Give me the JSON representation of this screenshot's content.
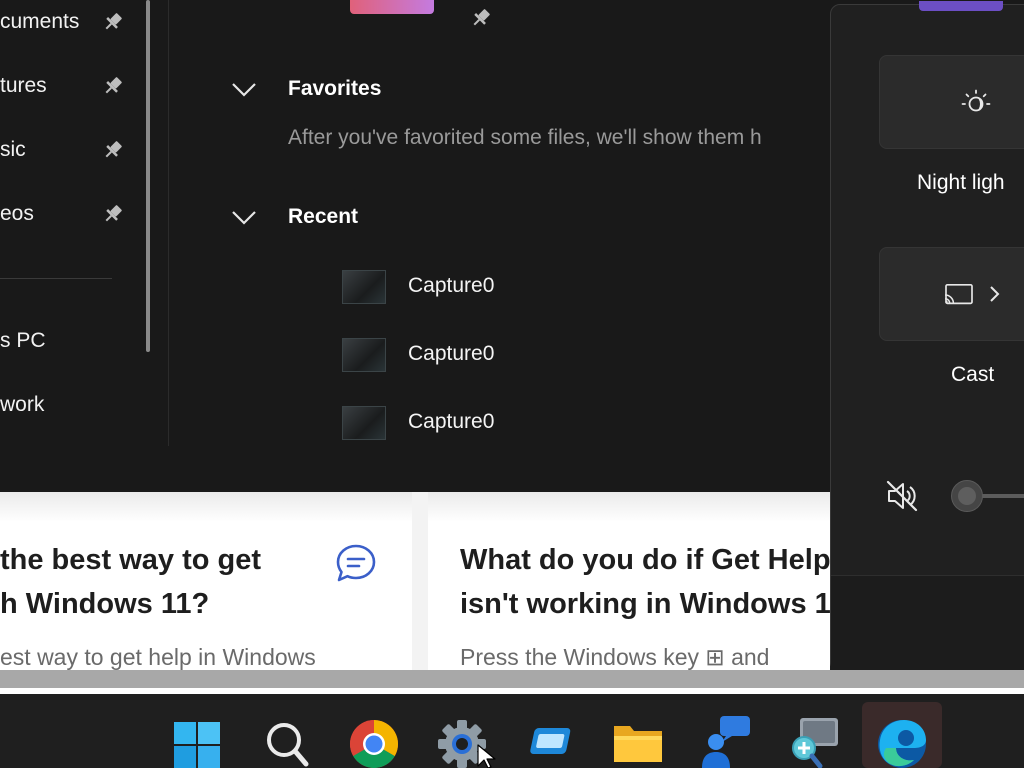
{
  "explorer": {
    "nav_items": [
      {
        "label": "cuments",
        "pinned": true
      },
      {
        "label": "tures",
        "pinned": true
      },
      {
        "label": "sic",
        "pinned": true
      },
      {
        "label": "eos",
        "pinned": true
      },
      {
        "label": "s PC",
        "pinned": false
      },
      {
        "label": "work",
        "pinned": false
      }
    ],
    "favorites": {
      "title": "Favorites",
      "message": "After you've favorited some files, we'll show them h"
    },
    "recent": {
      "title": "Recent",
      "items": [
        {
          "name": "Capture0"
        },
        {
          "name": "Capture0"
        },
        {
          "name": "Capture0"
        }
      ]
    }
  },
  "quick_settings": {
    "tiles": [
      {
        "label": "Night ligh",
        "icon": "night-light-icon"
      },
      {
        "label": "Cast",
        "icon": "cast-icon"
      }
    ],
    "volume": {
      "muted": true,
      "level": 0
    }
  },
  "help_page": {
    "cards": [
      {
        "title_line1": "the best way to get",
        "title_line2": "h Windows 11?",
        "body": "est way to get help in Windows"
      },
      {
        "title_line1": "What do you do if Get Help",
        "title_line2": "isn't working in Windows 1",
        "body": "Press the Windows key ⊞ and"
      }
    ]
  },
  "taskbar": {
    "apps": [
      {
        "name": "start-icon"
      },
      {
        "name": "search-icon"
      },
      {
        "name": "chrome-icon"
      },
      {
        "name": "settings-icon"
      },
      {
        "name": "app-window-icon"
      },
      {
        "name": "file-explorer-icon"
      },
      {
        "name": "get-help-icon"
      },
      {
        "name": "magnifier-icon"
      },
      {
        "name": "edge-icon"
      }
    ]
  },
  "colors": {
    "explorer_bg": "#191919",
    "flyout_bg": "#202020",
    "help_bg": "#ffffff",
    "help_accent": "#3b5fc9"
  }
}
